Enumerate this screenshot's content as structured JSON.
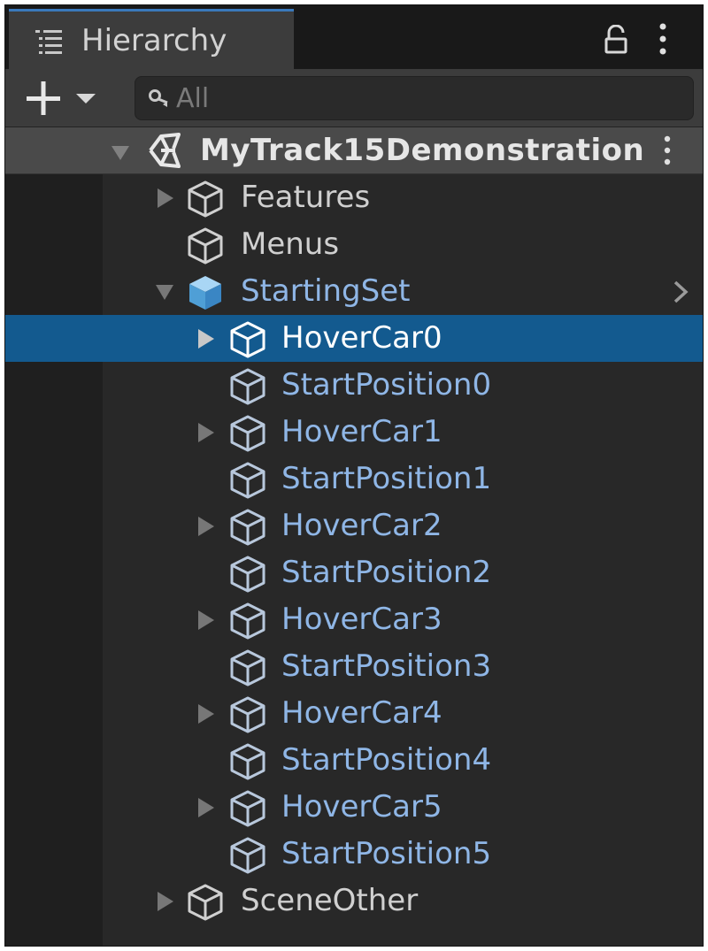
{
  "panel": {
    "title": "Hierarchy",
    "icons": {
      "tab": "list-icon",
      "lock": "lock-icon",
      "menu": "more-vert-icon"
    }
  },
  "toolbar": {
    "add_icon": "plus-icon",
    "dropdown_icon": "caret-down-icon",
    "search_icon": "search-icon",
    "search_placeholder": "All"
  },
  "tree": {
    "scene": {
      "label": "MyTrack15Demonstration",
      "icon": "unity-logo-icon",
      "expanded": true
    },
    "items": [
      {
        "label": "Features",
        "icon": "cube-icon",
        "expandable": true
      },
      {
        "label": "Menus",
        "icon": "cube-icon",
        "expandable": false
      },
      {
        "label": "StartingSet",
        "icon": "prefab-cube-icon",
        "expandable": true,
        "expanded": true
      },
      {
        "label": "HoverCar0",
        "icon": "cube-icon",
        "expandable": true,
        "selected": true
      },
      {
        "label": "StartPosition0",
        "icon": "cube-icon",
        "expandable": false
      },
      {
        "label": "HoverCar1",
        "icon": "cube-icon",
        "expandable": true
      },
      {
        "label": "StartPosition1",
        "icon": "cube-icon",
        "expandable": false
      },
      {
        "label": "HoverCar2",
        "icon": "cube-icon",
        "expandable": true
      },
      {
        "label": "StartPosition2",
        "icon": "cube-icon",
        "expandable": false
      },
      {
        "label": "HoverCar3",
        "icon": "cube-icon",
        "expandable": true
      },
      {
        "label": "StartPosition3",
        "icon": "cube-icon",
        "expandable": false
      },
      {
        "label": "HoverCar4",
        "icon": "cube-icon",
        "expandable": true
      },
      {
        "label": "StartPosition4",
        "icon": "cube-icon",
        "expandable": false
      },
      {
        "label": "HoverCar5",
        "icon": "cube-icon",
        "expandable": true
      },
      {
        "label": "StartPosition5",
        "icon": "cube-icon",
        "expandable": false
      },
      {
        "label": "SceneOther",
        "icon": "cube-icon",
        "expandable": true
      }
    ]
  },
  "colors": {
    "selection": "#135a8f",
    "prefab_text": "#8fb6e6",
    "normal_text": "#d0d0d0",
    "tab_accent": "#3a79bb"
  }
}
